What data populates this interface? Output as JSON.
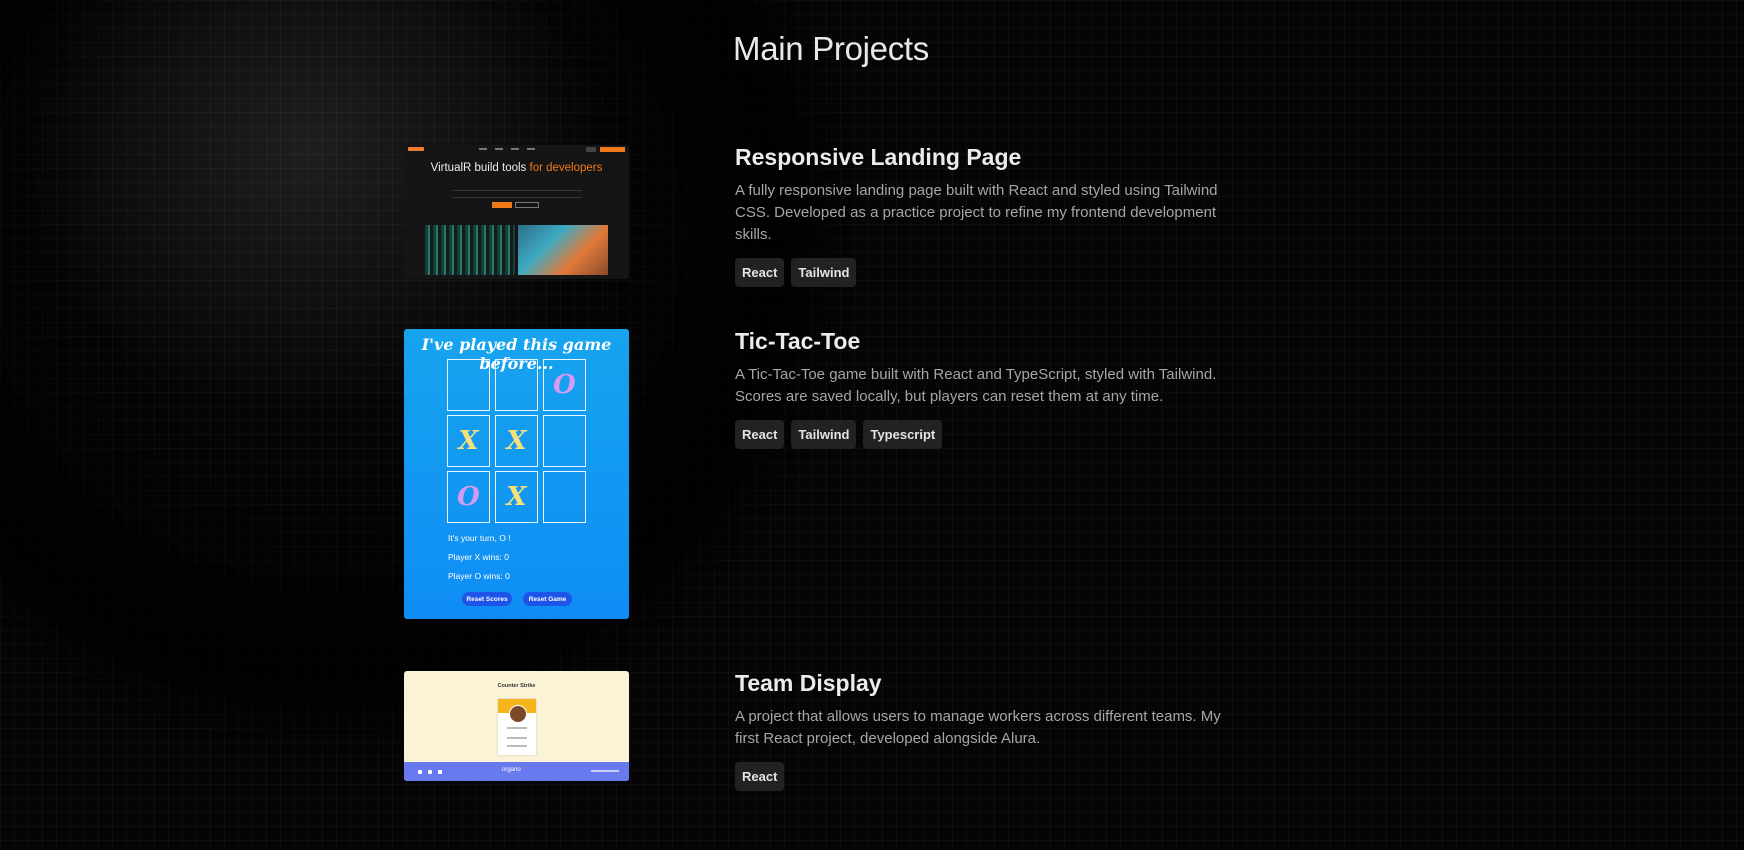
{
  "page": {
    "title": "Main Projects"
  },
  "projects": [
    {
      "title": "Responsive Landing Page",
      "description": "A fully responsive landing page built with React and styled using Tailwind CSS. Developed as a practice project to refine my frontend development skills.",
      "tags": [
        "React",
        "Tailwind"
      ],
      "thumbnail": {
        "headline_main": "VirtualR build tools ",
        "headline_accent": "for developers",
        "accent_color": "#f07a1a"
      }
    },
    {
      "title": "Tic-Tac-Toe",
      "description": "A Tic-Tac-Toe game built with React and TypeScript, styled with Tailwind. Scores are saved locally, but players can reset them at any time.",
      "tags": [
        "React",
        "Tailwind",
        "Typescript"
      ],
      "thumbnail": {
        "heading": "I've played this game before...",
        "board": [
          "",
          "",
          "O",
          "X",
          "X",
          "",
          "O",
          "X",
          ""
        ],
        "turn_text": "It's your turn, O !",
        "x_wins": "Player X wins: 0",
        "o_wins": "Player O wins: 0",
        "reset_scores": "Reset Scores",
        "reset_game": "Reset Game"
      }
    },
    {
      "title": "Team Display",
      "description": "A project that allows users to manage workers across different teams. My first React project, developed alongside Alura.",
      "tags": [
        "React"
      ],
      "thumbnail": {
        "team_heading": "Counter Strike",
        "brand": "organo"
      }
    }
  ],
  "colors": {
    "background": "#050505",
    "tag_bg": "#222222",
    "accent": "#f07a1a"
  }
}
